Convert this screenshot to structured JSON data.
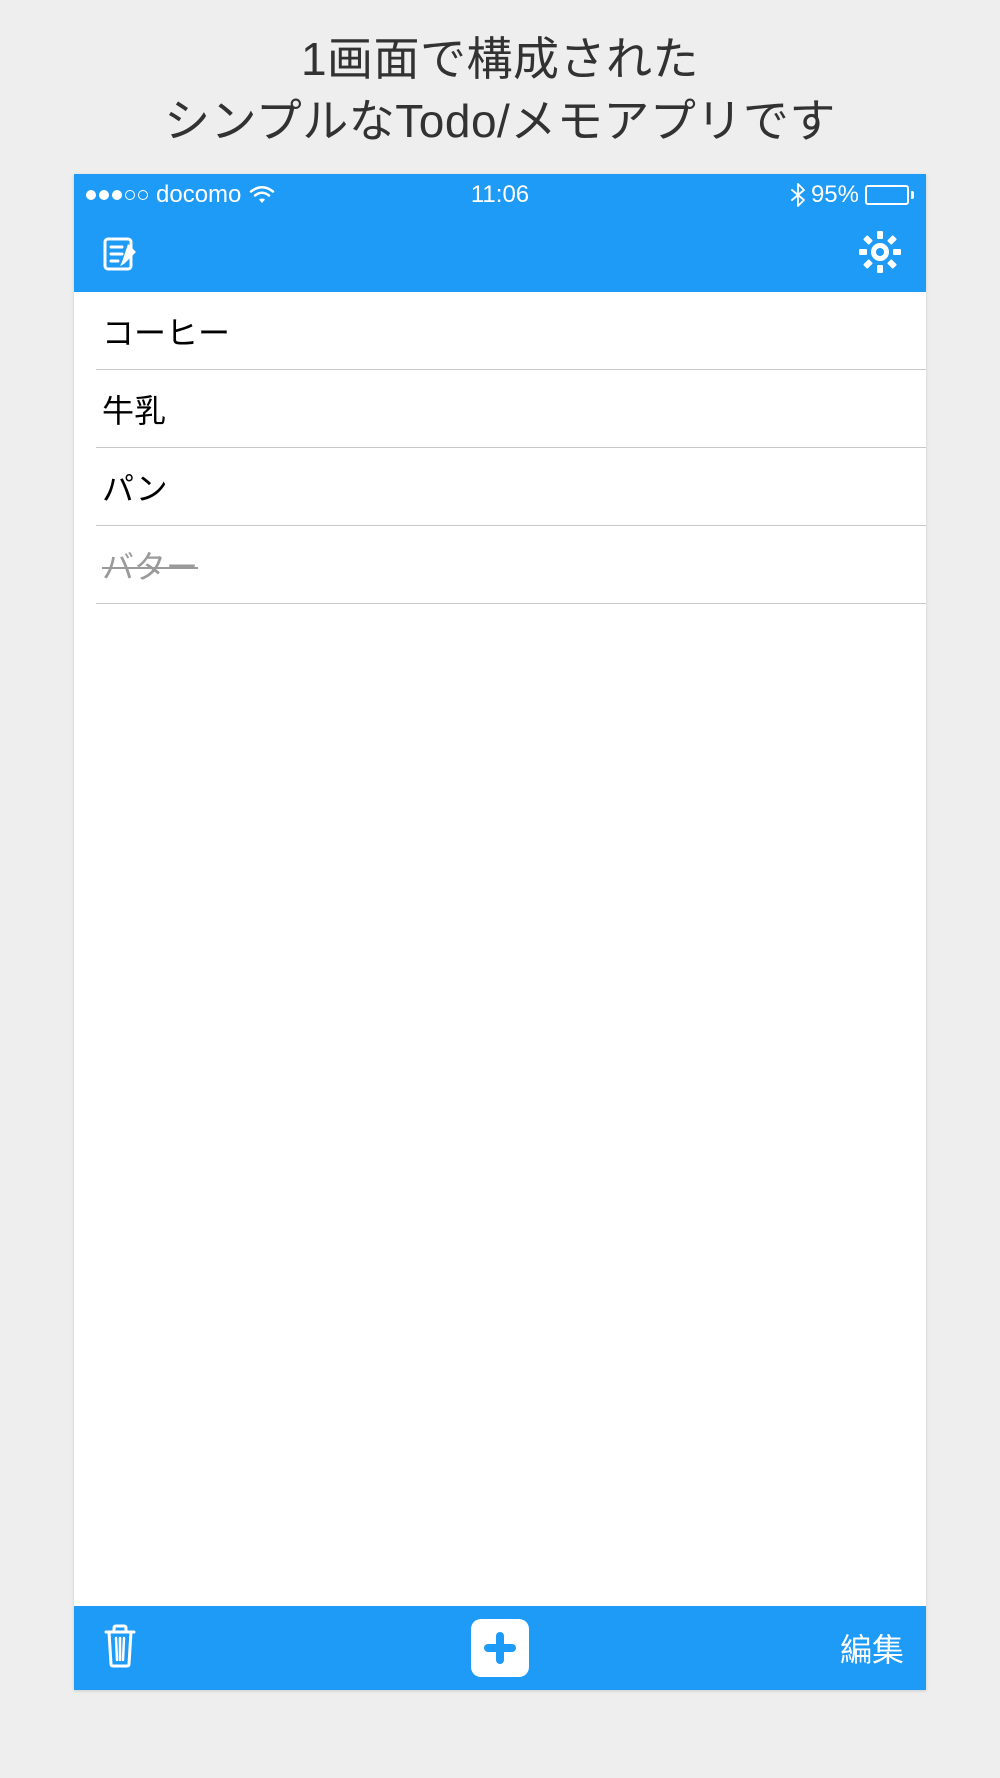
{
  "marketing": {
    "line1": "1画面で構成された",
    "line2": "シンプルなTodo/メモアプリです"
  },
  "statusBar": {
    "carrier": "docomo",
    "time": "11:06",
    "batteryPercent": "95%",
    "batteryFillPct": 95
  },
  "colors": {
    "accent": "#1e9af7",
    "bodyBg": "#eeeeee"
  },
  "list": {
    "items": [
      {
        "label": "コーヒー",
        "done": false
      },
      {
        "label": "牛乳",
        "done": false
      },
      {
        "label": "パン",
        "done": false
      },
      {
        "label": "バター",
        "done": true
      }
    ]
  },
  "toolbar": {
    "edit_label": "編集"
  }
}
